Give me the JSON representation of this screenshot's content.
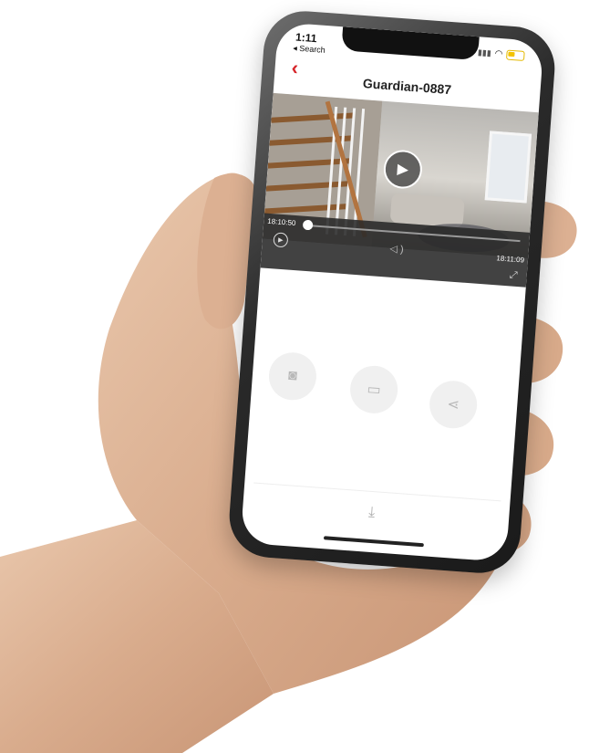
{
  "status_bar": {
    "time": "1:11",
    "back_label": "◂ Search",
    "signal": "▮▮▮",
    "wifi": "wifi"
  },
  "header": {
    "back_icon": "chevron-left-icon",
    "title": "Guardian-0887"
  },
  "video": {
    "play_icon": "play-icon"
  },
  "playback": {
    "time_start": "18:10:50",
    "time_end": "18:11:09",
    "progress_fraction": 0.02,
    "play_icon": "play-circle-icon",
    "volume_icon": "volume-icon",
    "fullscreen_icon": "fullscreen-icon"
  },
  "actions": [
    {
      "icon": "camera-icon",
      "glyph": "📷"
    },
    {
      "icon": "video-record-icon",
      "glyph": "▭"
    },
    {
      "icon": "share-icon",
      "glyph": "⋖"
    }
  ],
  "download_icon": "download-icon",
  "colors": {
    "accent": "#d6252a",
    "control_bar": "#282828",
    "battery": "#f3c300"
  }
}
